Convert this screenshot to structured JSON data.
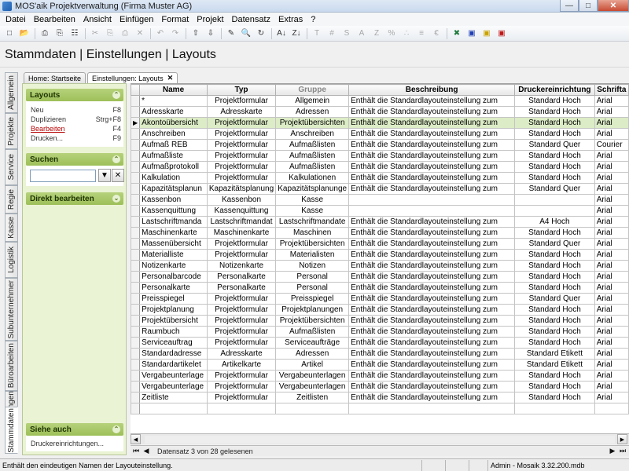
{
  "window": {
    "title": "MOS'aik Projektverwaltung (Firma Muster AG)"
  },
  "menu": [
    "Datei",
    "Bearbeiten",
    "Ansicht",
    "Einfügen",
    "Format",
    "Projekt",
    "Datensatz",
    "Extras",
    "?"
  ],
  "page": {
    "title": "Stammdaten | Einstellungen | Layouts"
  },
  "vertical_tabs": [
    "Allgemein",
    "Projekte",
    "Service",
    "Regie",
    "Kasse",
    "Logistik",
    "Subunternehmer",
    "Büroarbeiten",
    "Auswertungen",
    "Stammdaten"
  ],
  "doc_tabs": [
    {
      "label": "Home: Startseite"
    },
    {
      "label": "Einstellungen: Layouts"
    }
  ],
  "left_panel": {
    "layouts_title": "Layouts",
    "actions": [
      {
        "label": "Neu",
        "shortcut": "F8"
      },
      {
        "label": "Duplizieren",
        "shortcut": "Strg+F8"
      },
      {
        "label": "Bearbeiten",
        "shortcut": "F4"
      },
      {
        "label": "Drucken...",
        "shortcut": "F9"
      }
    ],
    "search_title": "Suchen",
    "direct_edit_title": "Direkt bearbeiten",
    "see_also_title": "Siehe auch",
    "see_also_link": "Druckereinrichtungen..."
  },
  "grid": {
    "columns": [
      "Name",
      "Typ",
      "Gruppe",
      "Beschreibung",
      "Druckereinrichtung",
      "Schrifta"
    ],
    "rows": [
      [
        "*",
        "Projektformular",
        "Allgemein",
        "Enthält die Standardlayouteinstellung zum",
        "Standard Hoch",
        "Arial"
      ],
      [
        "Adresskarte",
        "Adresskarte",
        "Adressen",
        "Enthält die Standardlayouteinstellung zum",
        "Standard Hoch",
        "Arial"
      ],
      [
        "Akontoübersicht",
        "Projektformular",
        "Projektübersichten",
        "Enthält die Standardlayouteinstellung zum",
        "Standard Hoch",
        "Arial"
      ],
      [
        "Anschreiben",
        "Projektformular",
        "Anschreiben",
        "Enthält die Standardlayouteinstellung zum",
        "Standard Hoch",
        "Arial"
      ],
      [
        "Aufmaß REB",
        "Projektformular",
        "Aufmaßlisten",
        "Enthält die Standardlayouteinstellung zum",
        "Standard Quer",
        "Courier"
      ],
      [
        "Aufmaßliste",
        "Projektformular",
        "Aufmaßlisten",
        "Enthält die Standardlayouteinstellung zum",
        "Standard Hoch",
        "Arial"
      ],
      [
        "Aufmaßprotokoll",
        "Projektformular",
        "Aufmaßlisten",
        "Enthält die Standardlayouteinstellung zum",
        "Standard Hoch",
        "Arial"
      ],
      [
        "Kalkulation",
        "Projektformular",
        "Kalkulationen",
        "Enthält die Standardlayouteinstellung zum",
        "Standard Hoch",
        "Arial"
      ],
      [
        "Kapazitätsplanun",
        "Kapazitätsplanung",
        "Kapazitätsplanunge",
        "Enthält die Standardlayouteinstellung zum",
        "Standard Quer",
        "Arial"
      ],
      [
        "Kassenbon",
        "Kassenbon",
        "Kasse",
        "",
        "",
        "Arial"
      ],
      [
        "Kassenquittung",
        "Kassenquittung",
        "Kasse",
        "",
        "",
        "Arial"
      ],
      [
        "Lastschriftmanda",
        "Lastschriftmandat",
        "Lastschriftmandate",
        "Enthält die Standardlayouteinstellung zum",
        "A4 Hoch",
        "Arial"
      ],
      [
        "Maschinenkarte",
        "Maschinenkarte",
        "Maschinen",
        "Enthält die Standardlayouteinstellung zum",
        "Standard Hoch",
        "Arial"
      ],
      [
        "Massenübersicht",
        "Projektformular",
        "Projektübersichten",
        "Enthält die Standardlayouteinstellung zum",
        "Standard Quer",
        "Arial"
      ],
      [
        "Materialliste",
        "Projektformular",
        "Materialisten",
        "Enthält die Standardlayouteinstellung zum",
        "Standard Hoch",
        "Arial"
      ],
      [
        "Notizenkarte",
        "Notizenkarte",
        "Notizen",
        "Enthält die Standardlayouteinstellung zum",
        "Standard Hoch",
        "Arial"
      ],
      [
        "Personalbarcode",
        "Personalkarte",
        "Personal",
        "Enthält die Standardlayouteinstellung zum",
        "Standard Hoch",
        "Arial"
      ],
      [
        "Personalkarte",
        "Personalkarte",
        "Personal",
        "Enthält die Standardlayouteinstellung zum",
        "Standard Hoch",
        "Arial"
      ],
      [
        "Preisspiegel",
        "Projektformular",
        "Preisspiegel",
        "Enthält die Standardlayouteinstellung zum",
        "Standard Quer",
        "Arial"
      ],
      [
        "Projektplanung",
        "Projektformular",
        "Projektplanungen",
        "Enthält die Standardlayouteinstellung zum",
        "Standard Hoch",
        "Arial"
      ],
      [
        "Projektübersicht",
        "Projektformular",
        "Projektübersichten",
        "Enthält die Standardlayouteinstellung zum",
        "Standard Hoch",
        "Arial"
      ],
      [
        "Raumbuch",
        "Projektformular",
        "Aufmaßlisten",
        "Enthält die Standardlayouteinstellung zum",
        "Standard Hoch",
        "Arial"
      ],
      [
        "Serviceauftrag",
        "Projektformular",
        "Serviceaufträge",
        "Enthält die Standardlayouteinstellung zum",
        "Standard Hoch",
        "Arial"
      ],
      [
        "Standardadresse",
        "Adresskarte",
        "Adressen",
        "Enthält die Standardlayouteinstellung zum",
        "Standard Etikett",
        "Arial"
      ],
      [
        "Standardartikelet",
        "Artikelkarte",
        "Artikel",
        "Enthält die Standardlayouteinstellung zum",
        "Standard Etikett",
        "Arial"
      ],
      [
        "Vergabeunterlage",
        "Projektformular",
        "Vergabeunterlagen",
        "Enthält die Standardlayouteinstellung zum",
        "Standard Hoch",
        "Arial"
      ],
      [
        "Vergabeunterlage",
        "Projektformular",
        "Vergabeunterlagen",
        "Enthält die Standardlayouteinstellung zum",
        "Standard Hoch",
        "Arial"
      ],
      [
        "Zeitliste",
        "Projektformular",
        "Zeitlisten",
        "Enthält die Standardlayouteinstellung zum",
        "Standard Hoch",
        "Arial"
      ]
    ],
    "selected_index": 2
  },
  "navbar": {
    "text": "Datensatz 3 von 28 gelesenen"
  },
  "statusbar": {
    "message": "Enthält den eindeutigen Namen der Layouteinstellung.",
    "db": "Admin - Mosaik 3.32.200.mdb"
  }
}
